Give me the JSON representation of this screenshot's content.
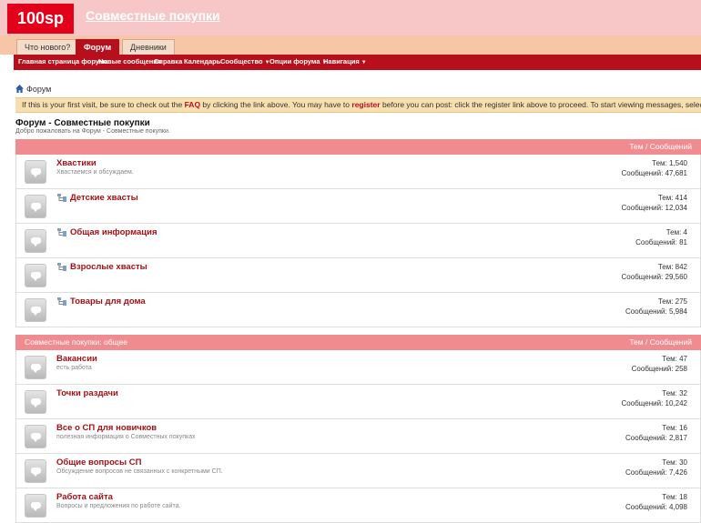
{
  "header": {
    "logo": "100sp",
    "site_title": "Совместные покупки"
  },
  "tabs": [
    {
      "label": "Что нового?",
      "active": false
    },
    {
      "label": "Форум",
      "active": true
    },
    {
      "label": "Дневники",
      "active": false
    }
  ],
  "navbar": [
    {
      "label": "Главная страница форума",
      "dropdown": false
    },
    {
      "label": "Новые сообщения",
      "dropdown": false
    },
    {
      "label": "Справка",
      "dropdown": false
    },
    {
      "label": "Календарь",
      "dropdown": false
    },
    {
      "label": "Сообщество",
      "dropdown": true
    },
    {
      "label": "Опции форума",
      "dropdown": true
    },
    {
      "label": "Навигация",
      "dropdown": true
    }
  ],
  "breadcrumb": "Форум",
  "notice": {
    "t1": "If this is your first visit, be sure to check out the ",
    "faq": "FAQ",
    "t2": " by clicking the link above. You may have to ",
    "register": "register",
    "t3": " before you can post: click the register link above to proceed. To start viewing messages, select the f"
  },
  "forum": {
    "title": "Форум - Совместные покупки",
    "subtitle": "Добро пожаловать на Форум - Совместные покупки."
  },
  "sections": [
    {
      "title": "",
      "stats_header": "Тем / Сообщений",
      "rows": [
        {
          "title": "Хвастики",
          "desc": "Хвастаемся и обсуждаем.",
          "subforum": false,
          "threads": "Тем: 1,540",
          "posts": "Сообщений: 47,681"
        },
        {
          "title": "Детские хвасты",
          "desc": "",
          "subforum": true,
          "threads": "Тем: 414",
          "posts": "Сообщений: 12,034"
        },
        {
          "title": "Общая информация",
          "desc": "",
          "subforum": true,
          "threads": "Тем: 4",
          "posts": "Сообщений: 81"
        },
        {
          "title": "Взрослые хвасты",
          "desc": "",
          "subforum": true,
          "threads": "Тем: 842",
          "posts": "Сообщений: 29,560"
        },
        {
          "title": "Товары для дома",
          "desc": "",
          "subforum": true,
          "threads": "Тем: 275",
          "posts": "Сообщений: 5,984"
        }
      ]
    },
    {
      "title": "Совместные покупки: общее",
      "stats_header": "Тем / Сообщений",
      "rows": [
        {
          "title": "Вакансии",
          "desc": "есть работа",
          "subforum": false,
          "threads": "Тем: 47",
          "posts": "Сообщений: 258"
        },
        {
          "title": "Точки раздачи",
          "desc": "",
          "subforum": false,
          "threads": "Тем: 32",
          "posts": "Сообщений: 10,242"
        },
        {
          "title": "Все о СП для новичков",
          "desc": "полезная информация о Совместных покупках",
          "subforum": false,
          "threads": "Тем: 16",
          "posts": "Сообщений: 2,817"
        },
        {
          "title": "Общие вопросы СП",
          "desc": "Обсуждение вопросов не связанных с конкретными СП.",
          "subforum": false,
          "threads": "Тем: 30",
          "posts": "Сообщений: 7,426"
        },
        {
          "title": "Работа сайта",
          "desc": "Вопросы и предложения по работе сайта.",
          "subforum": false,
          "threads": "Тем: 18",
          "posts": "Сообщений: 4,098"
        }
      ]
    }
  ],
  "colors": {
    "brand_red": "#e3001b",
    "nav_red": "#b80f1d",
    "section_pink": "#f08b90",
    "link_red": "#a60f14"
  }
}
